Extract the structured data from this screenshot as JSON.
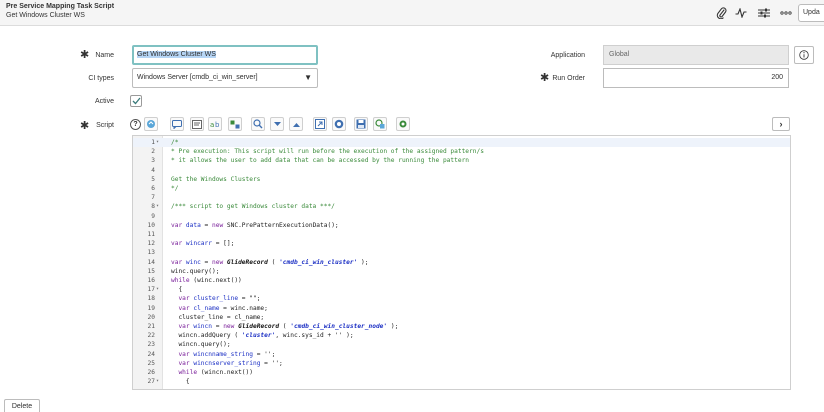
{
  "header": {
    "title": "Pre Service Mapping Task Script",
    "subtitle": "Get Windows Cluster WS",
    "update_label": "Upda"
  },
  "form": {
    "name_label": "Name",
    "name_value": "Get Windows Cluster WS",
    "ci_types_label": "CI types",
    "ci_types_value": "Windows Server [cmdb_ci_win_server]",
    "active_label": "Active",
    "active_checked": true,
    "script_label": "Script",
    "application_label": "Application",
    "application_value": "Global",
    "run_order_label": "Run Order",
    "run_order_value": "200"
  },
  "editor": {
    "lines": [
      [
        [
          "c",
          "/*"
        ]
      ],
      [
        [
          "c",
          "* Pre execution: This script will run before the execution of the assigned pattern/s"
        ]
      ],
      [
        [
          "c",
          "* it allows the user to add data that can be accessed by the running the pattern"
        ]
      ],
      [],
      [
        [
          "c",
          "Get the Windows Clusters"
        ]
      ],
      [
        [
          "c",
          "*/"
        ]
      ],
      [],
      [
        [
          "c",
          "/*** script to get Windows cluster data ***/"
        ]
      ],
      [],
      [
        [
          "k",
          "var "
        ],
        [
          "v",
          "data"
        ],
        [
          "p",
          " = "
        ],
        [
          "k",
          "new "
        ],
        [
          "p",
          "SNC.PrePatternExecutionData();"
        ]
      ],
      [],
      [
        [
          "k",
          "var "
        ],
        [
          "v",
          "wincarr"
        ],
        [
          "p",
          " = [];"
        ]
      ],
      [],
      [
        [
          "k",
          "var "
        ],
        [
          "v",
          "winc"
        ],
        [
          "p",
          " = "
        ],
        [
          "k",
          "new "
        ],
        [
          "t",
          "GlideRecord"
        ],
        [
          "p",
          " ( "
        ],
        [
          "s",
          "'cmdb_ci_win_cluster'"
        ],
        [
          "p",
          " );"
        ]
      ],
      [
        [
          "p",
          "winc.query();"
        ]
      ],
      [
        [
          "k",
          "while "
        ],
        [
          "p",
          "(winc.next())"
        ]
      ],
      [
        [
          "p",
          "  {"
        ]
      ],
      [
        [
          "k",
          "  var "
        ],
        [
          "v",
          "cluster_line"
        ],
        [
          "p",
          " = \"\";"
        ]
      ],
      [
        [
          "k",
          "  var "
        ],
        [
          "v",
          "cl_name"
        ],
        [
          "p",
          " = winc.name;"
        ]
      ],
      [
        [
          "p",
          "  cluster_line = cl_name;"
        ]
      ],
      [
        [
          "k",
          "  var "
        ],
        [
          "v",
          "wincn"
        ],
        [
          "p",
          " = "
        ],
        [
          "k",
          "new "
        ],
        [
          "t",
          "GlideRecord"
        ],
        [
          "p",
          " ( "
        ],
        [
          "s",
          "'cmdb_ci_win_cluster_node'"
        ],
        [
          "p",
          " );"
        ]
      ],
      [
        [
          "p",
          "  wincn.addQuery ( "
        ],
        [
          "s",
          "'cluster'"
        ],
        [
          "p",
          ", winc.sys_id + '' );"
        ]
      ],
      [
        [
          "p",
          "  wincn.query();"
        ]
      ],
      [
        [
          "k",
          "  var "
        ],
        [
          "v",
          "wincnname_string"
        ],
        [
          "p",
          " = '';"
        ]
      ],
      [
        [
          "k",
          "  var "
        ],
        [
          "v",
          "wincnserver_string"
        ],
        [
          "p",
          " = '';"
        ]
      ],
      [
        [
          "k",
          "  while "
        ],
        [
          "p",
          "(wincn.next())"
        ]
      ],
      [
        [
          "p",
          "    {"
        ]
      ]
    ],
    "fold_lines": [
      1,
      8,
      17,
      27
    ]
  },
  "footer": {
    "delete_label": "Delete"
  },
  "icons": [
    "paperclip-icon",
    "activity-icon",
    "sliders-icon",
    "more-icon",
    "info-icon",
    "help-icon",
    "chevron-right-icon",
    "dropdown-arrow-icon",
    "checkmark-icon"
  ]
}
